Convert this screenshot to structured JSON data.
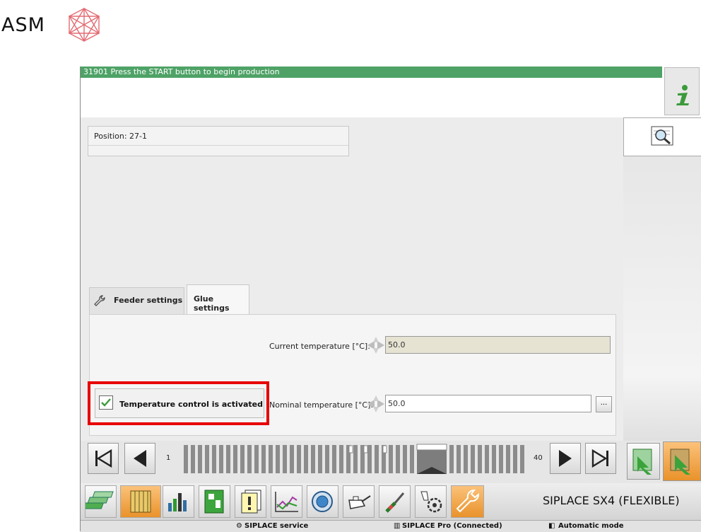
{
  "logo": {
    "text": "ASM"
  },
  "message": {
    "text": "31901 Press the START button to begin production"
  },
  "position": {
    "label": "Position: 27-1"
  },
  "tabs": [
    {
      "label": "Feeder settings"
    },
    {
      "label": "Glue settings"
    }
  ],
  "glue": {
    "current_label": "Current temperature [°C]:",
    "current_value": "50.0",
    "nominal_label": "Nominal temperature [°C]:",
    "nominal_value": "50.0",
    "more_button": "...",
    "temp_control_label": "Temperature control is activated",
    "temp_control_checked": true
  },
  "navigator": {
    "start_label": "1",
    "end_label": "40"
  },
  "machine_name": "SIPLACE SX4 (FLEXIBLE)",
  "status": {
    "service": "SIPLACE service",
    "pro": "SIPLACE Pro (Connected)",
    "mode": "Automatic mode"
  },
  "colors": {
    "message_bar": "#4ea266",
    "highlight": "#e80000",
    "active_tool": "#f6a54a"
  }
}
